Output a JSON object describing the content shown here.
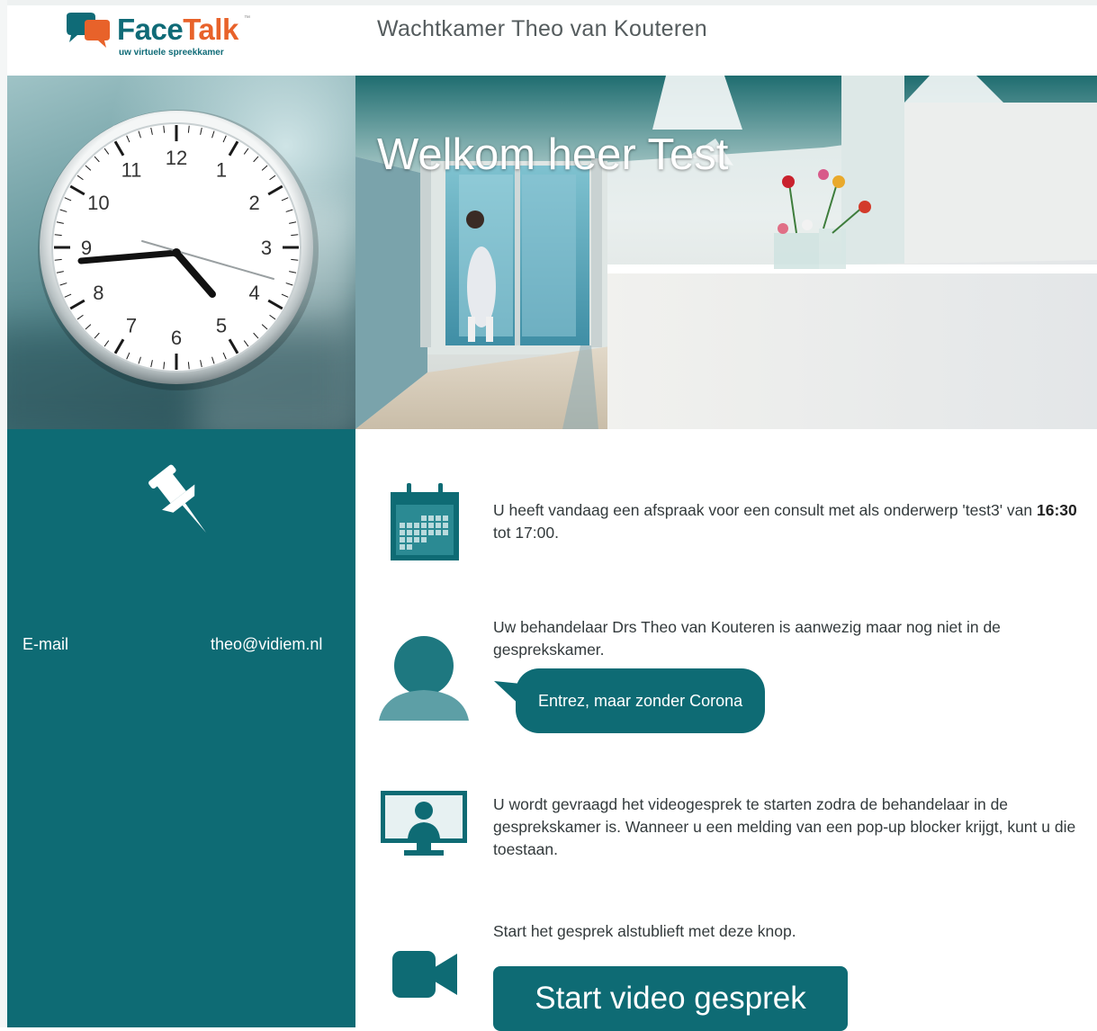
{
  "brand": {
    "name_part1": "Face",
    "name_part2": "Talk",
    "trademark": "™",
    "tagline": "uw virtuele spreekkamer",
    "colors": {
      "teal": "#0e6b74",
      "orange": "#e8622a"
    }
  },
  "header": {
    "title": "Wachtkamer Theo van Kouteren"
  },
  "hero": {
    "title": "Welkom heer Test"
  },
  "clock": {
    "numbers": [
      "12",
      "1",
      "2",
      "3",
      "4",
      "5",
      "6",
      "7",
      "8",
      "9",
      "10",
      "11"
    ],
    "time_shown": "16:44"
  },
  "sidebar": {
    "icon": "pushpin-icon",
    "email_label": "E-mail",
    "email_value": "theo@vidiem.nl"
  },
  "rows": {
    "appointment": {
      "icon": "calendar-icon",
      "text_before": "U heeft vandaag een afspraak voor een consult met als onderwerp 'test3' van ",
      "start_time": "16:30",
      "text_after": " tot 17:00."
    },
    "practitioner": {
      "icon": "person-icon",
      "text": "Uw behandelaar Drs Theo van Kouteren is aanwezig maar nog niet in de gesprekskamer.",
      "message": "Entrez, maar zonder Corona"
    },
    "video_instruction": {
      "icon": "monitor-user-icon",
      "text": "U wordt gevraagd het videogesprek te starten zodra de behandelaar in de gesprekskamer is. Wanneer u een melding van een pop-up blocker krijgt, kunt u die toestaan."
    },
    "start": {
      "icon": "video-camera-icon",
      "text": "Start het gesprek alstublieft met deze knop.",
      "button_label": "Start video gesprek"
    }
  }
}
